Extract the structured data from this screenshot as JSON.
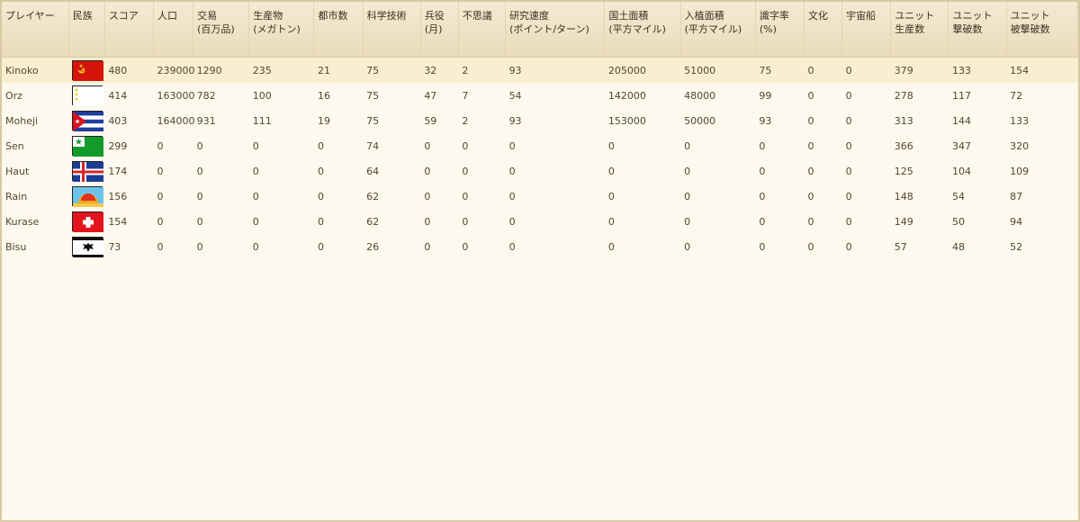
{
  "columns": [
    {
      "label": [
        "プレイヤー"
      ]
    },
    {
      "label": [
        "民族"
      ]
    },
    {
      "label": [
        "スコア"
      ]
    },
    {
      "label": [
        "人口"
      ]
    },
    {
      "label": [
        "交易",
        "(百万品)"
      ]
    },
    {
      "label": [
        "生産物",
        "(メガトン)"
      ]
    },
    {
      "label": [
        "都市数"
      ]
    },
    {
      "label": [
        "科学技術"
      ]
    },
    {
      "label": [
        "兵役",
        "(月)"
      ]
    },
    {
      "label": [
        "不思議"
      ]
    },
    {
      "label": [
        "研究速度",
        "(ポイント/ターン)"
      ]
    },
    {
      "label": [
        "国土面積",
        "(平方マイル)"
      ]
    },
    {
      "label": [
        "入植面積",
        "(平方マイル)"
      ]
    },
    {
      "label": [
        "識字率",
        "(%)"
      ]
    },
    {
      "label": [
        "文化"
      ]
    },
    {
      "label": [
        "宇宙船"
      ]
    },
    {
      "label": [
        "ユニット",
        "生産数"
      ]
    },
    {
      "label": [
        "ユニット",
        "撃破数"
      ]
    },
    {
      "label": [
        "ユニット",
        "被撃破数"
      ]
    }
  ],
  "rows": [
    {
      "player": "Kinoko",
      "flag": "soviet-flag-icon",
      "selected": true,
      "cells": [
        "480",
        "239000",
        "1290",
        "235",
        "21",
        "75",
        "32",
        "2",
        "93",
        "205000",
        "51000",
        "75",
        "0",
        "0",
        "379",
        "133",
        "154"
      ]
    },
    {
      "player": "Orz",
      "flag": "orz-flag-icon",
      "selected": false,
      "cells": [
        "414",
        "163000",
        "782",
        "100",
        "16",
        "75",
        "47",
        "7",
        "54",
        "142000",
        "48000",
        "99",
        "0",
        "0",
        "278",
        "117",
        "72"
      ]
    },
    {
      "player": "Moheji",
      "flag": "cuba-flag-icon",
      "selected": false,
      "cells": [
        "403",
        "164000",
        "931",
        "111",
        "19",
        "75",
        "59",
        "2",
        "93",
        "153000",
        "50000",
        "93",
        "0",
        "0",
        "313",
        "144",
        "133"
      ]
    },
    {
      "player": "Sen",
      "flag": "esperanto-flag-icon",
      "selected": false,
      "cells": [
        "299",
        "0",
        "0",
        "0",
        "0",
        "74",
        "0",
        "0",
        "0",
        "0",
        "0",
        "0",
        "0",
        "0",
        "366",
        "347",
        "320"
      ]
    },
    {
      "player": "Haut",
      "flag": "iceland-flag-icon",
      "selected": false,
      "cells": [
        "174",
        "0",
        "0",
        "0",
        "0",
        "64",
        "0",
        "0",
        "0",
        "0",
        "0",
        "0",
        "0",
        "0",
        "125",
        "104",
        "109"
      ]
    },
    {
      "player": "Rain",
      "flag": "rain-flag-icon",
      "selected": false,
      "cells": [
        "156",
        "0",
        "0",
        "0",
        "0",
        "62",
        "0",
        "0",
        "0",
        "0",
        "0",
        "0",
        "0",
        "0",
        "148",
        "54",
        "87"
      ]
    },
    {
      "player": "Kurase",
      "flag": "swiss-flag-icon",
      "selected": false,
      "cells": [
        "154",
        "0",
        "0",
        "0",
        "0",
        "62",
        "0",
        "0",
        "0",
        "0",
        "0",
        "0",
        "0",
        "0",
        "149",
        "50",
        "94"
      ]
    },
    {
      "player": "Bisu",
      "flag": "prussia-flag-icon",
      "selected": false,
      "cells": [
        "73",
        "0",
        "0",
        "0",
        "0",
        "26",
        "0",
        "0",
        "0",
        "0",
        "0",
        "0",
        "0",
        "0",
        "57",
        "48",
        "52"
      ]
    }
  ]
}
